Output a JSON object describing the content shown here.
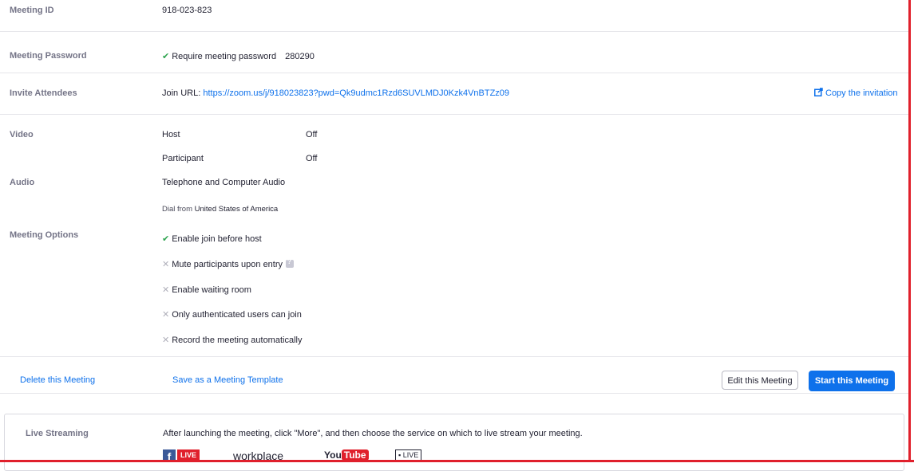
{
  "meeting_id": {
    "label": "Meeting ID",
    "value": "918-023-823"
  },
  "password": {
    "label": "Meeting Password",
    "text": "Require meeting password",
    "value": "280290"
  },
  "invite": {
    "label": "Invite Attendees",
    "join_prefix": "Join URL:",
    "join_url": "https://zoom.us/j/918023823?pwd=Qk9udmc1Rzd6SUVLMDJ0Kzk4VnBTZz09",
    "copy_label": "Copy the invitation"
  },
  "video": {
    "label": "Video",
    "host_label": "Host",
    "host_value": "Off",
    "participant_label": "Participant",
    "participant_value": "Off"
  },
  "audio": {
    "label": "Audio",
    "value": "Telephone and Computer Audio",
    "dial_prefix": "Dial from",
    "dial_country": "United States of America"
  },
  "options": {
    "label": "Meeting Options",
    "items": [
      {
        "text": "Enable join before host",
        "enabled": true
      },
      {
        "text": "Mute participants upon entry",
        "enabled": false
      },
      {
        "text": "Enable waiting room",
        "enabled": false
      },
      {
        "text": "Only authenticated users can join",
        "enabled": false
      },
      {
        "text": "Record the meeting automatically",
        "enabled": false
      }
    ]
  },
  "actions": {
    "delete": "Delete this Meeting",
    "save_template": "Save as a Meeting Template",
    "edit": "Edit this Meeting",
    "start": "Start this Meeting"
  },
  "live_streaming": {
    "label": "Live Streaming",
    "text": "After launching the meeting, click \"More\", and then choose the service on which to live stream your meeting.",
    "services": {
      "facebook_letter": "f",
      "facebook_badge": "LIVE",
      "workplace": "workplace",
      "youtube_you": "You",
      "youtube_tube": "Tube",
      "custom": "LIVE"
    }
  },
  "colors": {
    "accent": "#0e71eb",
    "check": "#2ea44f",
    "frame": "#e0202c"
  }
}
